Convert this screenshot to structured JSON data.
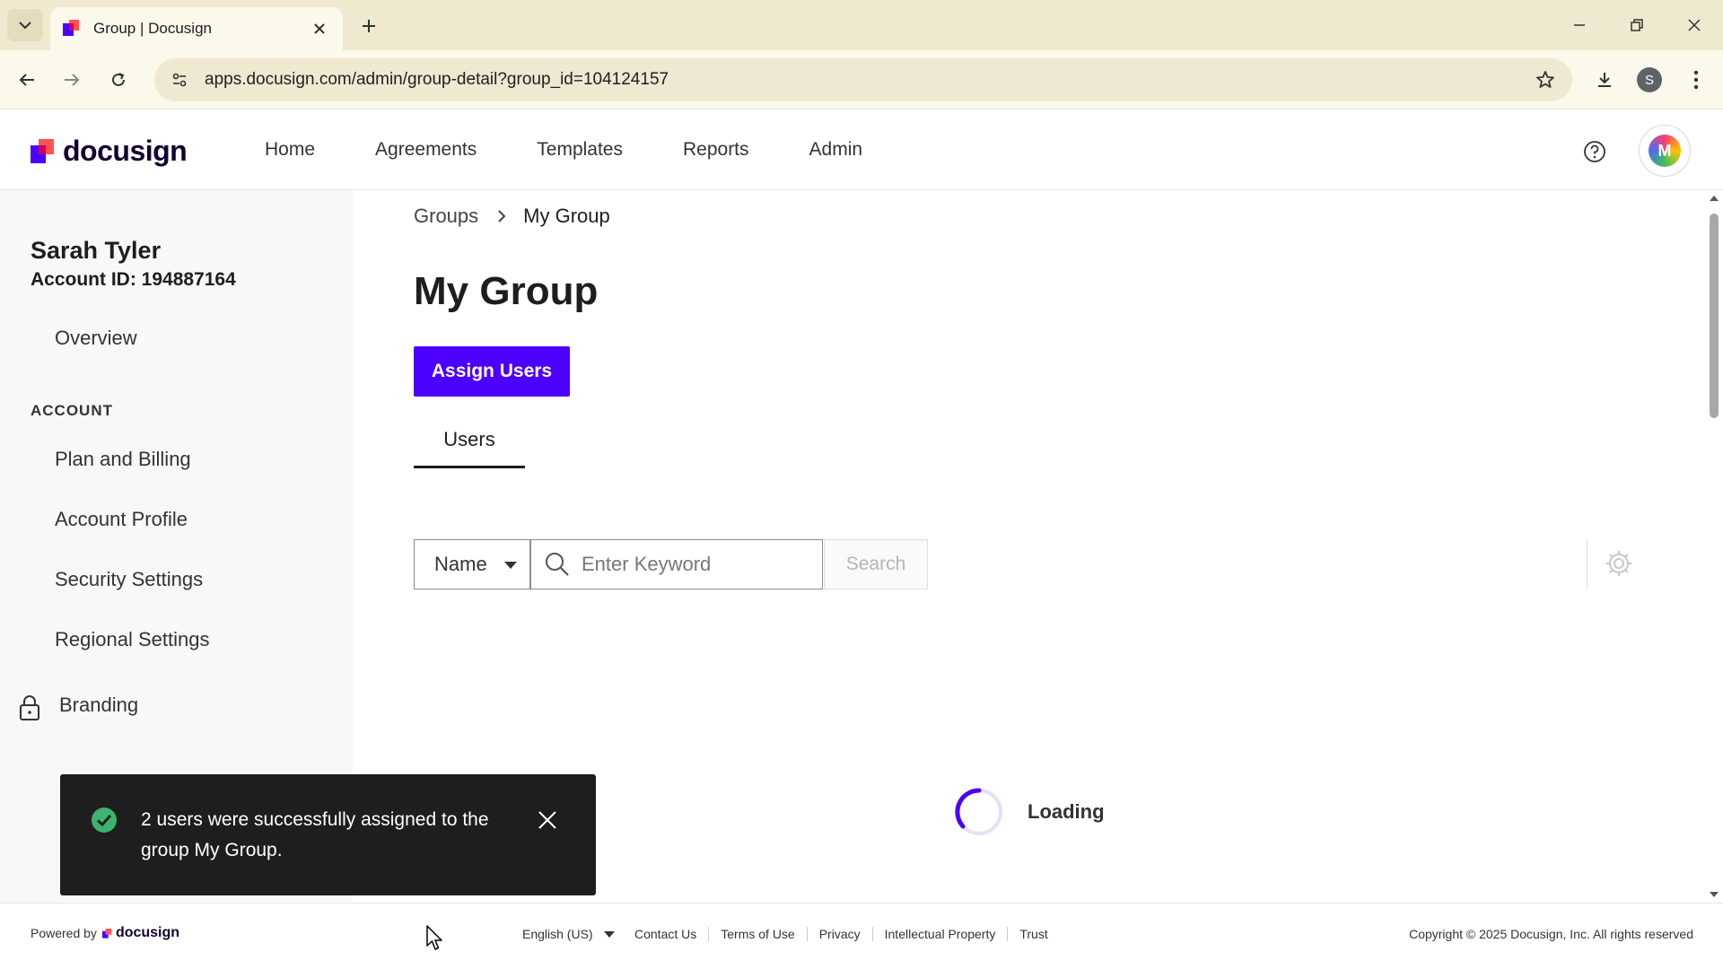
{
  "browser": {
    "tab_title": "Group | Docusign",
    "url": "apps.docusign.com/admin/group-detail?group_id=104124157",
    "profile_initial": "S"
  },
  "header": {
    "logo_text": "docusign",
    "nav": [
      "Home",
      "Agreements",
      "Templates",
      "Reports",
      "Admin"
    ],
    "avatar_initial": "M"
  },
  "sidebar": {
    "user_name": "Sarah Tyler",
    "account_id": "Account ID: 194887164",
    "overview": "Overview",
    "section_account": "ACCOUNT",
    "items": [
      "Plan and Billing",
      "Account Profile",
      "Security Settings",
      "Regional Settings",
      "Branding"
    ]
  },
  "main": {
    "breadcrumb": {
      "parent": "Groups",
      "current": "My Group"
    },
    "title": "My Group",
    "assign_button": "Assign Users",
    "tab_users": "Users",
    "filter_value": "Name",
    "search_placeholder": "Enter Keyword",
    "search_button": "Search",
    "loading_text": "Loading"
  },
  "toast": {
    "message": "2 users were successfully assigned to the group My Group."
  },
  "footer": {
    "powered_by": "Powered by",
    "logo_text": "docusign",
    "language": "English (US)",
    "links": [
      "Contact Us",
      "Terms of Use",
      "Privacy",
      "Intellectual Property",
      "Trust"
    ],
    "copyright": "Copyright © 2025 Docusign, Inc. All rights reserved"
  },
  "colors": {
    "brand_purple": "#4c00ff",
    "toast_bg": "#1e1e1e",
    "success_green": "#3cb371"
  },
  "icons": [
    "tab-list-icon",
    "favicon-icon",
    "close-icon",
    "plus-icon",
    "minimize-icon",
    "restore-icon",
    "back-icon",
    "forward-icon",
    "reload-icon",
    "site-info-icon",
    "star-icon",
    "download-icon",
    "kebab-icon",
    "help-icon",
    "lock-icon",
    "chevron-right-icon",
    "search-icon",
    "gear-icon",
    "spinner-icon",
    "check-circle-icon"
  ]
}
